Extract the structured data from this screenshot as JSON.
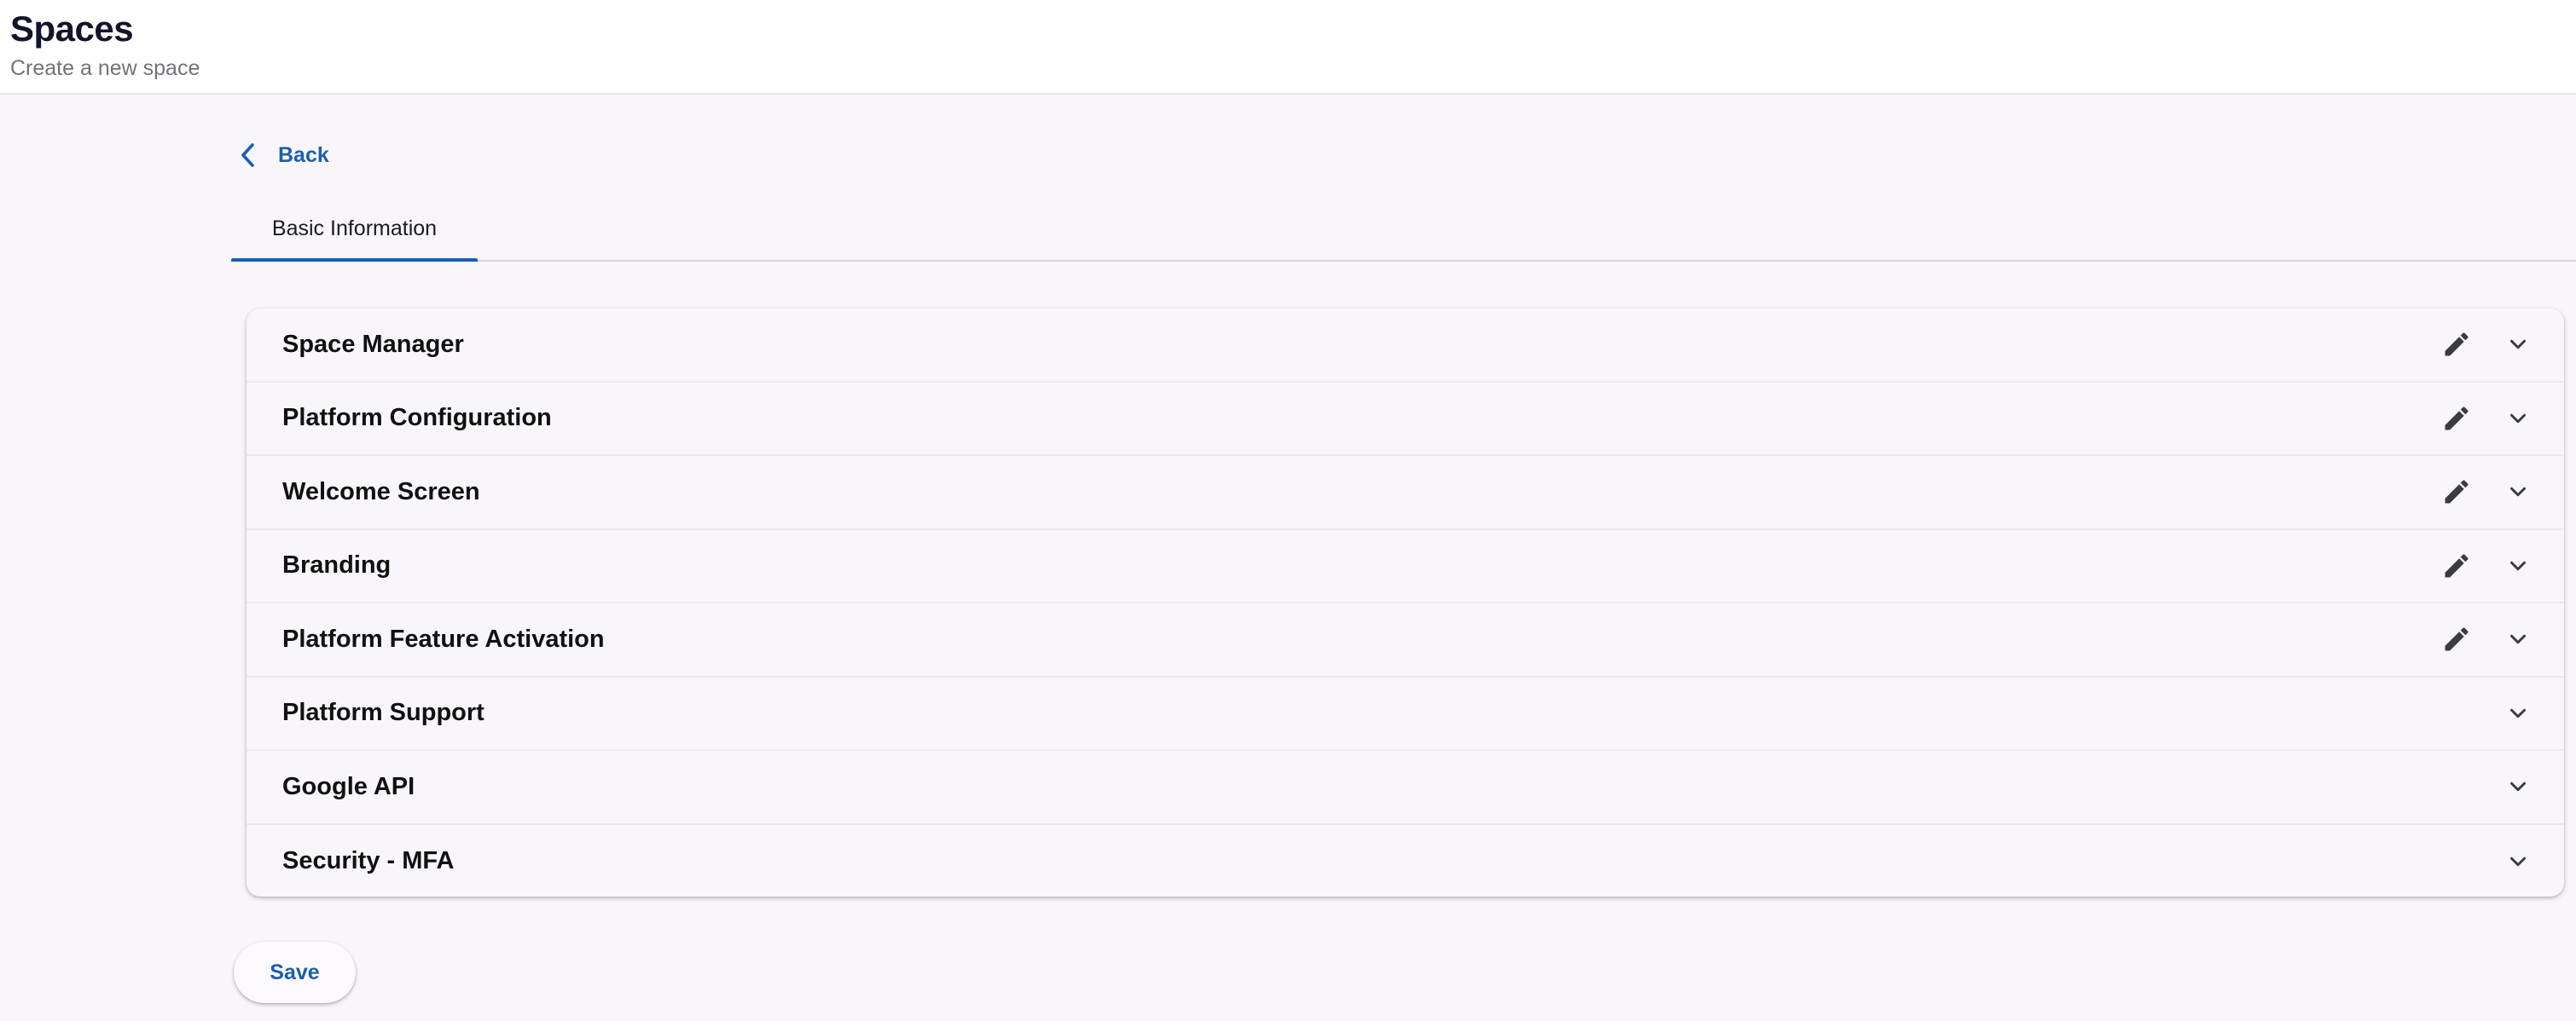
{
  "header": {
    "title": "Spaces",
    "subtitle": "Create a new space"
  },
  "back": {
    "label": "Back",
    "icon": "chevron-left-icon"
  },
  "tabs": [
    {
      "label": "Basic Information",
      "active": true
    }
  ],
  "sections": [
    {
      "title": "Space Manager",
      "editable": true
    },
    {
      "title": "Platform Configuration",
      "editable": true
    },
    {
      "title": "Welcome Screen",
      "editable": true
    },
    {
      "title": "Branding",
      "editable": true
    },
    {
      "title": "Platform Feature Activation",
      "editable": true
    },
    {
      "title": "Platform Support",
      "editable": false
    },
    {
      "title": "Google API",
      "editable": false
    },
    {
      "title": "Security - MFA",
      "editable": false
    }
  ],
  "icons": {
    "edit": "pencil-icon",
    "expand": "chevron-down-icon"
  },
  "actions": {
    "save_label": "Save"
  },
  "colors": {
    "accent": "#1b5fb0",
    "background": "#f8f6fa",
    "header_bg": "#ffffff",
    "icon": "#3c3c3c"
  }
}
